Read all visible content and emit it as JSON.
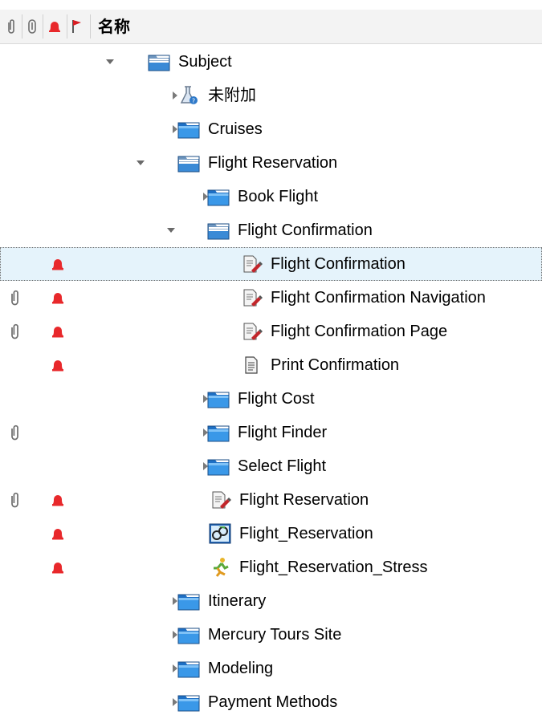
{
  "header": {
    "title": "名称",
    "column_icons": [
      "attachment-icon",
      "attachment-outline-icon",
      "alert-bell-icon",
      "flag-icon"
    ]
  },
  "colors": {
    "selected_row_bg": "#e5f3fb",
    "alert_red": "#e8282b",
    "folder_blue": "#2f8fe0"
  },
  "tree": [
    {
      "label": "Subject",
      "icon": "folder-open-icon",
      "expander": "expanded",
      "level": 0,
      "attach": false,
      "alert": false,
      "selected": false
    },
    {
      "label": "未附加",
      "icon": "unattached-flask-icon",
      "expander": "collapsed",
      "level": 1,
      "attach": false,
      "alert": false,
      "selected": false
    },
    {
      "label": "Cruises",
      "icon": "folder-icon",
      "expander": "collapsed",
      "level": 1,
      "attach": false,
      "alert": false,
      "selected": false
    },
    {
      "label": "Flight Reservation",
      "icon": "folder-open-icon",
      "expander": "expanded",
      "level": 1,
      "attach": false,
      "alert": false,
      "selected": false
    },
    {
      "label": "Book Flight",
      "icon": "folder-icon",
      "expander": "collapsed",
      "level": 2,
      "attach": false,
      "alert": false,
      "selected": false
    },
    {
      "label": "Flight Confirmation",
      "icon": "folder-open-icon",
      "expander": "expanded",
      "level": 2,
      "attach": false,
      "alert": false,
      "selected": false
    },
    {
      "label": "Flight Confirmation",
      "icon": "manual-test-icon",
      "expander": "none",
      "level": 3,
      "attach": false,
      "alert": true,
      "selected": true
    },
    {
      "label": "Flight Confirmation Navigation",
      "icon": "manual-test-icon",
      "expander": "none",
      "level": 3,
      "attach": true,
      "alert": true,
      "selected": false
    },
    {
      "label": "Flight Confirmation Page",
      "icon": "manual-test-icon",
      "expander": "none",
      "level": 3,
      "attach": true,
      "alert": true,
      "selected": false
    },
    {
      "label": "Print Confirmation",
      "icon": "document-icon",
      "expander": "none",
      "level": 3,
      "attach": false,
      "alert": true,
      "selected": false
    },
    {
      "label": "Flight Cost",
      "icon": "folder-icon",
      "expander": "collapsed",
      "level": 2,
      "attach": false,
      "alert": false,
      "selected": false
    },
    {
      "label": "Flight Finder",
      "icon": "folder-icon",
      "expander": "collapsed",
      "level": 2,
      "attach": true,
      "alert": false,
      "selected": false
    },
    {
      "label": "Select Flight",
      "icon": "folder-icon",
      "expander": "collapsed",
      "level": 2,
      "attach": false,
      "alert": false,
      "selected": false
    },
    {
      "label": "Flight Reservation",
      "icon": "manual-test-icon",
      "expander": "none",
      "level": 2,
      "attach": true,
      "alert": true,
      "selected": false
    },
    {
      "label": "Flight_Reservation",
      "icon": "automated-test-icon",
      "expander": "none",
      "level": 2,
      "attach": false,
      "alert": true,
      "selected": false
    },
    {
      "label": "Flight_Reservation_Stress",
      "icon": "performance-test-icon",
      "expander": "none",
      "level": 2,
      "attach": false,
      "alert": true,
      "selected": false
    },
    {
      "label": "Itinerary",
      "icon": "folder-icon",
      "expander": "collapsed",
      "level": 1,
      "attach": false,
      "alert": false,
      "selected": false
    },
    {
      "label": "Mercury Tours Site",
      "icon": "folder-icon",
      "expander": "collapsed",
      "level": 1,
      "attach": false,
      "alert": false,
      "selected": false
    },
    {
      "label": "Modeling",
      "icon": "folder-icon",
      "expander": "collapsed",
      "level": 1,
      "attach": false,
      "alert": false,
      "selected": false
    },
    {
      "label": "Payment Methods",
      "icon": "folder-icon",
      "expander": "collapsed",
      "level": 1,
      "attach": false,
      "alert": false,
      "selected": false
    }
  ]
}
